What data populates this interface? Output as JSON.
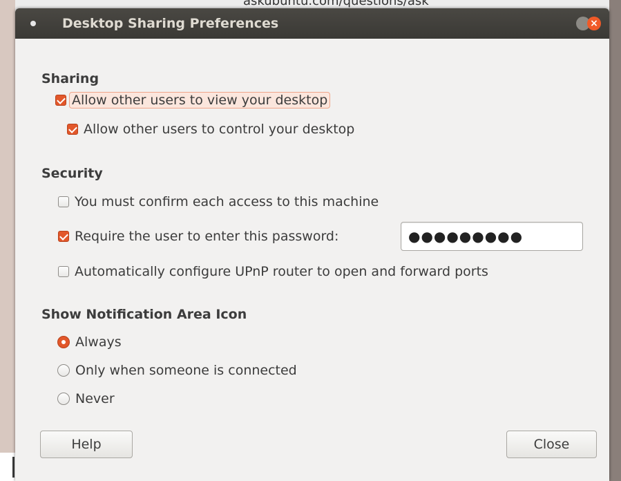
{
  "background": {
    "url_text": "askubuntu.com/questions/ask"
  },
  "window": {
    "title": "Desktop Sharing Preferences",
    "close_glyph": "×"
  },
  "sharing": {
    "title": "Sharing",
    "allow_view": {
      "label": "Allow other users to view your desktop",
      "checked": true
    },
    "allow_control": {
      "label": "Allow other users to control your desktop",
      "checked": true
    }
  },
  "security": {
    "title": "Security",
    "confirm_access": {
      "label": "You must confirm each access to this machine",
      "checked": false
    },
    "require_password": {
      "label": "Require the user to enter this password:",
      "checked": true
    },
    "password_value": "●●●●●●●●●",
    "upnp": {
      "label": "Automatically configure UPnP router to open and forward ports",
      "checked": false
    }
  },
  "notification": {
    "title": "Show Notification Area Icon",
    "options": [
      {
        "label": "Always",
        "selected": true
      },
      {
        "label": "Only when someone is connected",
        "selected": false
      },
      {
        "label": "Never",
        "selected": false
      }
    ]
  },
  "buttons": {
    "help": "Help",
    "close": "Close"
  },
  "colors": {
    "accent": "#e2572a",
    "titlebar": "#3e3c38",
    "window_bg": "#f2f1f0"
  }
}
